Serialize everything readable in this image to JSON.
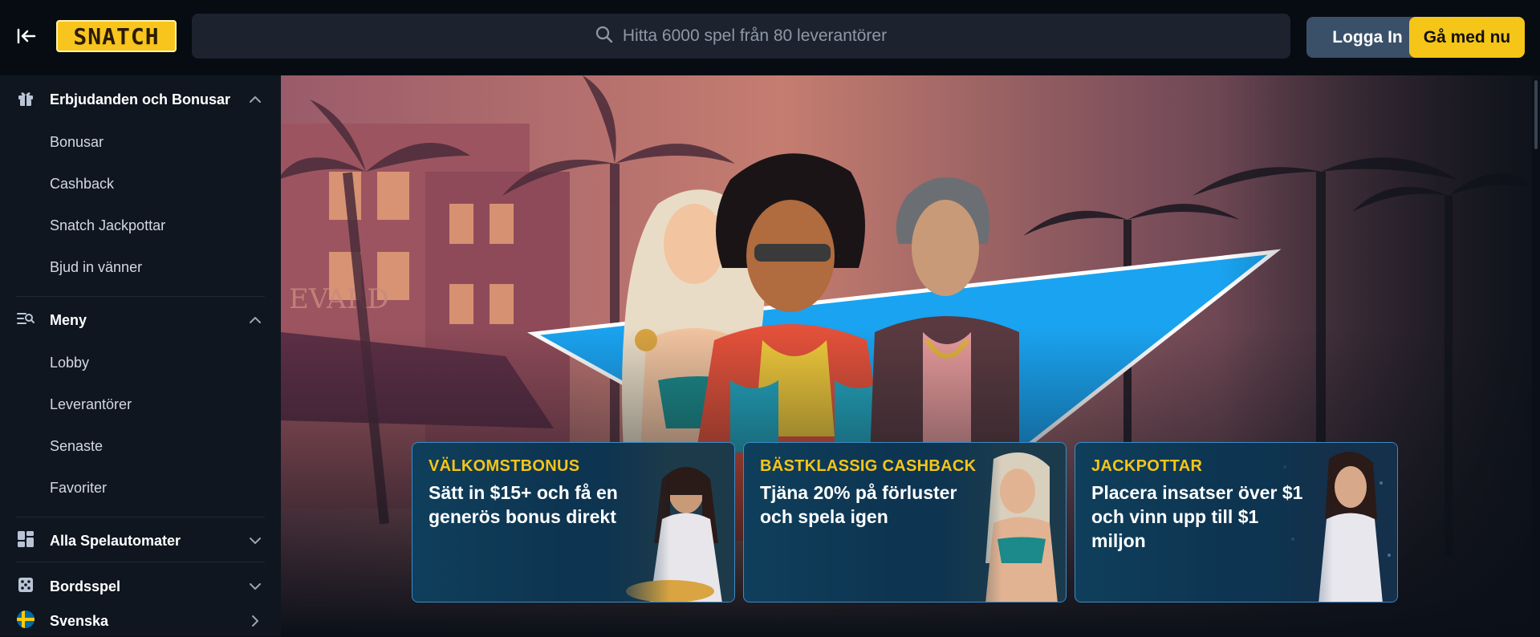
{
  "header": {
    "logo_text": "SNATCH",
    "search_placeholder": "Hitta 6000 spel från 80 leverantörer",
    "login_label": "Logga In",
    "join_label": "Gå med nu"
  },
  "sidebar": {
    "offers": {
      "label": "Erbjudanden och Bonusar",
      "icon": "gift-icon",
      "items": [
        "Bonusar",
        "Cashback",
        "Snatch Jackpottar",
        "Bjud in vänner"
      ]
    },
    "menu": {
      "label": "Meny",
      "icon": "menu-search-icon",
      "items": [
        "Lobby",
        "Leverantörer",
        "Senaste",
        "Favoriter"
      ]
    },
    "slots": {
      "label": "Alla Spelautomater",
      "icon": "grid-icon"
    },
    "table": {
      "label": "Bordsspel",
      "icon": "dice-icon"
    },
    "language": {
      "label": "Svenska",
      "icon": "sweden-flag-icon"
    }
  },
  "promos": [
    {
      "kicker": "VÄLKOMSTBONUS",
      "text": "Sätt in $15+ och få en generös bonus direkt"
    },
    {
      "kicker": "BÄSTKLASSIG CASHBACK",
      "text": "Tjäna 20% på förluster och spela igen"
    },
    {
      "kicker": "JACKPOTTAR",
      "text": "Placera insatser över $1 och vinn upp till $1 miljon"
    }
  ],
  "colors": {
    "accent_yellow": "#f5c518",
    "login_bg": "#3a5068",
    "promo_border": "#3b8cc8",
    "triangle_blue": "#1aa3f0"
  }
}
